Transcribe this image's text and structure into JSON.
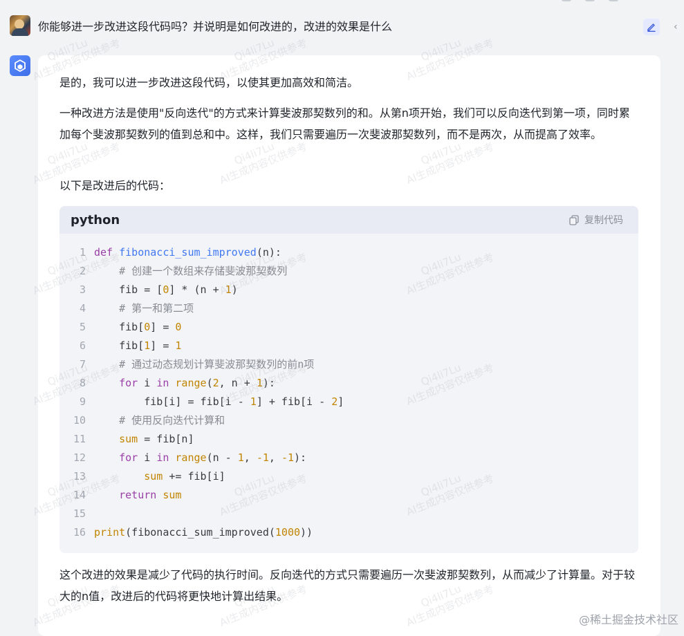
{
  "question": {
    "text": "你能够进一步改进这段代码吗？并说明是如何改进的，改进的效果是什么"
  },
  "icons": {
    "edit": "pencil-icon",
    "collapse": "chevron-left-icon",
    "copy": "copy-icon",
    "bot": "cube-logo-icon"
  },
  "answer": {
    "p1": "是的，我可以进一步改进这段代码，以使其更加高效和简洁。",
    "p2": "一种改进方法是使用\"反向迭代\"的方式来计算斐波那契数列的和。从第n项开始，我们可以反向迭代到第一项，同时累加每个斐波那契数列的值到总和中。这样，我们只需要遍历一次斐波那契数列，而不是两次，从而提高了效率。",
    "p3": "以下是改进后的代码：",
    "p4": "这个改进的效果是减少了代码的执行时间。反向迭代的方式只需要遍历一次斐波那契数列，从而减少了计算量。对于较大的n值，改进后的代码将更快地计算出结果。"
  },
  "code": {
    "language": "python",
    "copy_label": "复制代码",
    "lines": [
      [
        {
          "t": "def",
          "c": "kw"
        },
        {
          "t": " "
        },
        {
          "t": "fibonacci_sum_improved",
          "c": "fn"
        },
        {
          "t": "(n):"
        }
      ],
      [
        {
          "t": "    "
        },
        {
          "t": "# 创建一个数组来存储斐波那契数列",
          "c": "cm"
        }
      ],
      [
        {
          "t": "    fib = ["
        },
        {
          "t": "0",
          "c": "num"
        },
        {
          "t": "] * (n + "
        },
        {
          "t": "1",
          "c": "num"
        },
        {
          "t": ")"
        }
      ],
      [
        {
          "t": "    "
        },
        {
          "t": "# 第一和第二项",
          "c": "cm"
        }
      ],
      [
        {
          "t": "    fib["
        },
        {
          "t": "0",
          "c": "num"
        },
        {
          "t": "] = "
        },
        {
          "t": "0",
          "c": "num"
        }
      ],
      [
        {
          "t": "    fib["
        },
        {
          "t": "1",
          "c": "num"
        },
        {
          "t": "] = "
        },
        {
          "t": "1",
          "c": "num"
        }
      ],
      [
        {
          "t": "    "
        },
        {
          "t": "# 通过动态规划计算斐波那契数列的前n项",
          "c": "cm"
        }
      ],
      [
        {
          "t": "    "
        },
        {
          "t": "for",
          "c": "kw"
        },
        {
          "t": " i "
        },
        {
          "t": "in",
          "c": "kw"
        },
        {
          "t": " "
        },
        {
          "t": "range",
          "c": "num"
        },
        {
          "t": "("
        },
        {
          "t": "2",
          "c": "num"
        },
        {
          "t": ", n + "
        },
        {
          "t": "1",
          "c": "num"
        },
        {
          "t": "):"
        }
      ],
      [
        {
          "t": "        fib[i] = fib[i - "
        },
        {
          "t": "1",
          "c": "num"
        },
        {
          "t": "] + fib[i - "
        },
        {
          "t": "2",
          "c": "num"
        },
        {
          "t": "]"
        }
      ],
      [
        {
          "t": "    "
        },
        {
          "t": "# 使用反向迭代计算和",
          "c": "cm"
        }
      ],
      [
        {
          "t": "    "
        },
        {
          "t": "sum",
          "c": "num"
        },
        {
          "t": " = fib[n]"
        }
      ],
      [
        {
          "t": "    "
        },
        {
          "t": "for",
          "c": "kw"
        },
        {
          "t": " i "
        },
        {
          "t": "in",
          "c": "kw"
        },
        {
          "t": " "
        },
        {
          "t": "range",
          "c": "num"
        },
        {
          "t": "(n - "
        },
        {
          "t": "1",
          "c": "num"
        },
        {
          "t": ", "
        },
        {
          "t": "-1",
          "c": "num"
        },
        {
          "t": ", "
        },
        {
          "t": "-1",
          "c": "num"
        },
        {
          "t": "):"
        }
      ],
      [
        {
          "t": "        "
        },
        {
          "t": "sum",
          "c": "num"
        },
        {
          "t": " += fib[i]"
        }
      ],
      [
        {
          "t": "    "
        },
        {
          "t": "return",
          "c": "kw"
        },
        {
          "t": " "
        },
        {
          "t": "sum",
          "c": "num"
        }
      ],
      [],
      [
        {
          "t": "print",
          "c": "num"
        },
        {
          "t": "(fibonacci_sum_improved("
        },
        {
          "t": "1000",
          "c": "num"
        },
        {
          "t": "))"
        }
      ]
    ]
  },
  "watermark": {
    "line1": "Qi4li7Lu",
    "line2": "AI生成内容仅供参考"
  },
  "footer": {
    "source": "@稀土掘金技术社区"
  }
}
